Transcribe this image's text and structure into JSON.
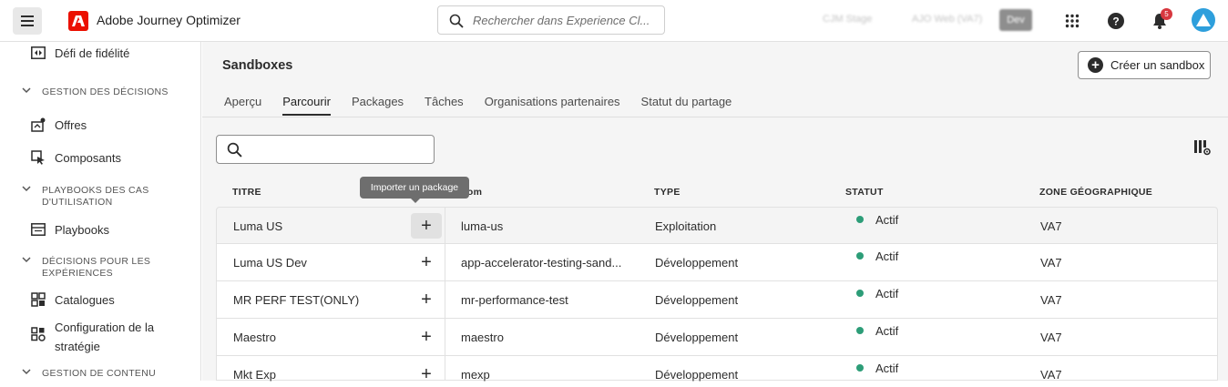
{
  "app": {
    "title": "Adobe Journey Optimizer"
  },
  "search": {
    "placeholder": "Rechercher dans Experience Cl..."
  },
  "header": {
    "org1": "CJM Stage",
    "org2": "AJO Web (VA7)",
    "env_badge": "Dev",
    "notifications_count": "5"
  },
  "sidebar": {
    "item_top": "Défi de fidélité",
    "sections": [
      {
        "label": "GESTION DES DÉCISIONS"
      },
      {
        "label_line1": "PLAYBOOKS DES CAS",
        "label_line2": "D'UTILISATION"
      },
      {
        "label_line1": "DÉCISIONS POUR LES",
        "label_line2": "EXPÉRIENCES"
      },
      {
        "label": "GESTION DE CONTENU"
      }
    ],
    "items": {
      "offres": "Offres",
      "composants": "Composants",
      "playbooks": "Playbooks",
      "catalogues": "Catalogues",
      "config_line1": "Configuration de la",
      "config_line2": "stratégie"
    }
  },
  "main": {
    "title": "Sandboxes",
    "create_button": "Créer un sandbox",
    "tabs": [
      "Aperçu",
      "Parcourir",
      "Packages",
      "Tâches",
      "Organisations partenaires",
      "Statut du partage"
    ],
    "active_tab": "Parcourir",
    "tooltip": "Importer un package",
    "columns": {
      "title": "TITRE",
      "name": "Nom",
      "type": "TYPE",
      "status": "STATUT",
      "region": "ZONE GÉOGRAPHIQUE"
    },
    "rows": [
      {
        "title": "Luma US",
        "name": "luma-us",
        "type": "Exploitation",
        "status": "Actif",
        "region": "VA7"
      },
      {
        "title": "Luma US Dev",
        "name": "app-accelerator-testing-sand...",
        "type": "Développement",
        "status": "Actif",
        "region": "VA7"
      },
      {
        "title": "MR PERF TEST(ONLY)",
        "name": "mr-performance-test",
        "type": "Développement",
        "status": "Actif",
        "region": "VA7"
      },
      {
        "title": "Maestro",
        "name": "maestro",
        "type": "Développement",
        "status": "Actif",
        "region": "VA7"
      },
      {
        "title": "Mkt Exp",
        "name": "mexp",
        "type": "Développement",
        "status": "Actif",
        "region": "VA7"
      }
    ]
  },
  "colors": {
    "brand": "#eb1000",
    "status_active": "#2d9d78",
    "notification": "#d7373f",
    "avatar": "#2e9fdc"
  }
}
